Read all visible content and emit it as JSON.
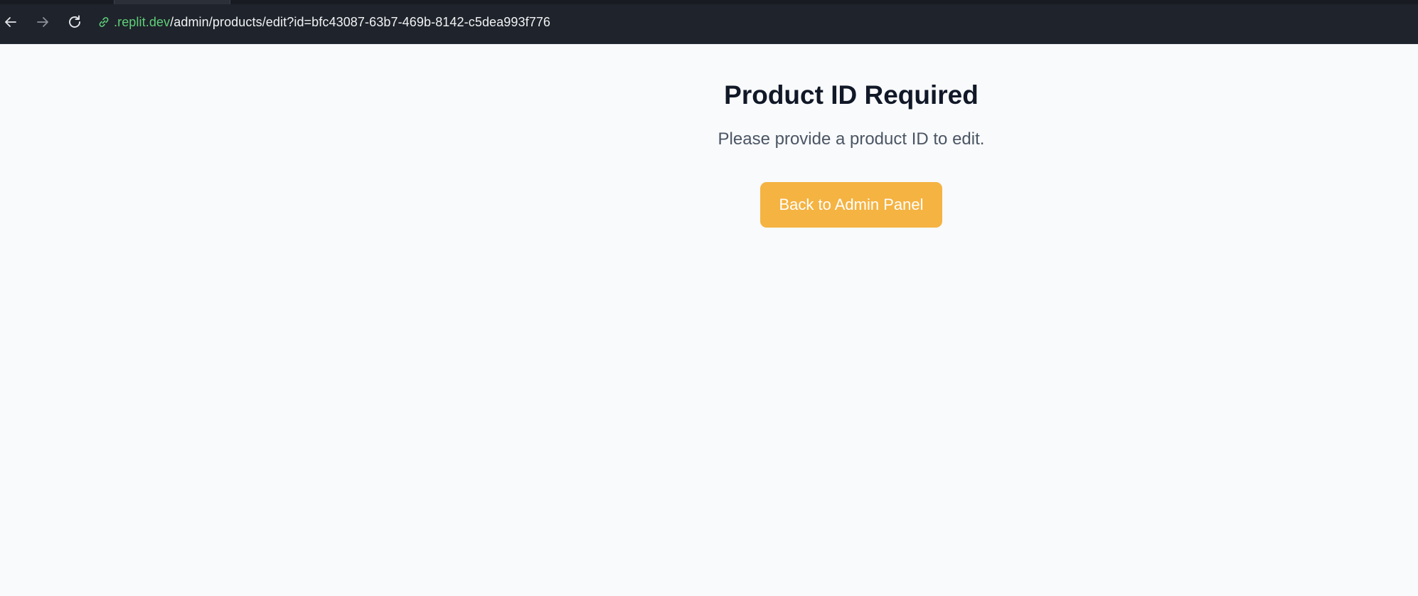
{
  "browser": {
    "url_domain": ".replit.dev",
    "url_path": "/admin/products/edit?id=bfc43087-63b7-469b-8142-c5dea993f776",
    "icons": {
      "back": "arrow-left-icon",
      "forward": "arrow-right-icon",
      "reload": "reload-icon",
      "link": "link-icon"
    }
  },
  "page": {
    "title": "Product ID Required",
    "message": "Please provide a product ID to edit.",
    "back_button_label": "Back to Admin Panel"
  },
  "colors": {
    "accent_button": "#f5b342",
    "url_domain": "#5fd07a",
    "background": "#f8fafc",
    "title_text": "#111827",
    "message_text": "#4b5563"
  }
}
